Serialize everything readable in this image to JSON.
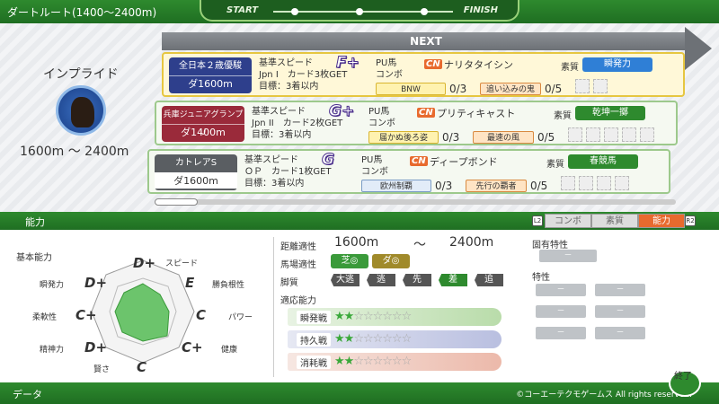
{
  "top": {
    "title": "ダートルート(1400～2400m)",
    "start": "START",
    "finish": "FINISH"
  },
  "horse": {
    "name": "インプライド",
    "range": "1600m ～ 2400m"
  },
  "next_label": "NEXT",
  "races": [
    {
      "name": "全日本２歳優駿",
      "dist": "ダ1600m",
      "grade": "F+",
      "req1": "基準スピード",
      "req2": "Jpn I　カード3枚GET",
      "req3": "目標：3着以内",
      "pu_label": "PU馬",
      "combo_label": "コンボ",
      "pu_name": "ナリタタイシン",
      "combo1": "BNW",
      "frac1": "0/3",
      "combo2": "追い込みの鬼",
      "frac2": "0/5",
      "sosh_label": "素質",
      "sosh": "瞬発力"
    },
    {
      "name": "兵庫ジュニアグランプリ",
      "dist": "ダ1400m",
      "grade": "G+",
      "req1": "基準スピード",
      "req2": "Jpn II　カード2枚GET",
      "req3": "目標：3着以内",
      "pu_label": "PU馬",
      "combo_label": "コンボ",
      "pu_name": "プリティキャスト",
      "combo1": "届かぬ後ろ姿",
      "frac1": "0/3",
      "combo2": "最速の風",
      "frac2": "0/5",
      "sosh_label": "素質",
      "sosh": "乾坤一擲"
    },
    {
      "name": "カトレアS",
      "dist": "ダ1600m",
      "grade": "G",
      "req1": "基準スピード",
      "req2": "ＯＰ　カード1枚GET",
      "req3": "目標：3着以内",
      "pu_label": "PU馬",
      "combo_label": "コンボ",
      "pu_name": "ディープボンド",
      "combo1": "欧州制覇",
      "frac1": "0/3",
      "combo2": "先行の覇者",
      "frac2": "0/5",
      "sosh_label": "素質",
      "sosh": "春競馬"
    }
  ],
  "section": {
    "label": "能力",
    "tabs": [
      "コンボ",
      "素質",
      "能力"
    ],
    "active_tab": 2
  },
  "abilities": {
    "title": "基本能力",
    "items": [
      {
        "label": "スピード",
        "grade": "D+"
      },
      {
        "label": "勝負根性",
        "grade": "E"
      },
      {
        "label": "パワー",
        "grade": "C"
      },
      {
        "label": "健康",
        "grade": "C+"
      },
      {
        "label": "賢さ",
        "grade": "C"
      },
      {
        "label": "精神力",
        "grade": "D+"
      },
      {
        "label": "柔軟性",
        "grade": "C+"
      },
      {
        "label": "瞬発力",
        "grade": "D+"
      }
    ]
  },
  "aptitude": {
    "dist_label": "距離適性",
    "dist_min": "1600m",
    "tilde": "～",
    "dist_max": "2400m",
    "ground_label": "馬場適性",
    "turf": "芝◎",
    "dirt": "ダ◎",
    "style_label": "脚質",
    "styles": [
      "大逃",
      "逃",
      "先",
      "差",
      "追"
    ],
    "style_active": 3,
    "battle_label": "適応能力",
    "battles": [
      {
        "label": "瞬発戦",
        "stars": 2,
        "max": 8
      },
      {
        "label": "持久戦",
        "stars": 2,
        "max": 8
      },
      {
        "label": "消耗戦",
        "stars": 2,
        "max": 8
      }
    ]
  },
  "traits": {
    "unique_label": "固有特性",
    "unique_slots": [
      "－"
    ],
    "trait_label": "特性",
    "slots": [
      "－",
      "－",
      "－",
      "－",
      "－",
      "－"
    ]
  },
  "bottom": {
    "data": "データ",
    "copyright": "©コーエーテクモゲームス All rights reserved.",
    "end": "終了"
  },
  "colors": {
    "green": "#2e8a2e",
    "orange": "#e86a2e",
    "blue_race": "#2e3f8c",
    "red_race": "#9a2a3a",
    "gray_race": "#5a5e62"
  }
}
